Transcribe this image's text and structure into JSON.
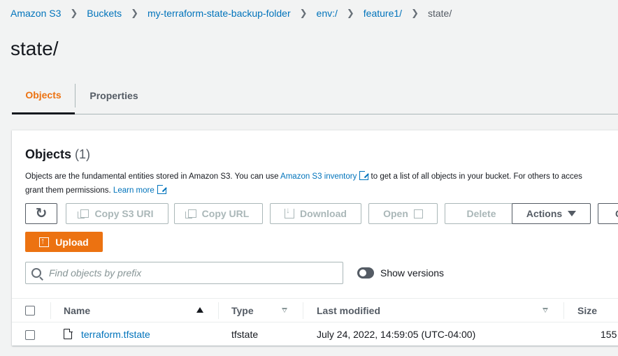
{
  "breadcrumb": {
    "items": [
      "Amazon S3",
      "Buckets",
      "my-terraform-state-backup-folder",
      "env:/",
      "feature1/"
    ],
    "current": "state/"
  },
  "page_title": "state/",
  "tabs": [
    {
      "label": "Objects",
      "active": true
    },
    {
      "label": "Properties",
      "active": false
    }
  ],
  "objects_panel": {
    "title": "Objects",
    "count": "(1)",
    "description_prefix": "Objects are the fundamental entities stored in Amazon S3. You can use ",
    "inventory_link": "Amazon S3 inventory",
    "description_middle": " to get a list of all objects in your bucket. For others to acces",
    "description_line2": "grant them permissions. ",
    "learn_more_link": "Learn more"
  },
  "toolbar": {
    "copy_uri_label": "Copy S3 URI",
    "copy_url_label": "Copy URL",
    "download_label": "Download",
    "open_label": "Open",
    "delete_label": "Delete",
    "actions_label": "Actions",
    "create_label": "C",
    "upload_label": "Upload"
  },
  "search": {
    "placeholder": "Find objects by prefix"
  },
  "show_versions": {
    "label": "Show versions",
    "enabled": false
  },
  "table": {
    "columns": [
      "Name",
      "Type",
      "Last modified",
      "Size"
    ],
    "rows": [
      {
        "name": "terraform.tfstate",
        "type": "tfstate",
        "last_modified": "July 24, 2022, 14:59:05 (UTC-04:00)",
        "size": "155"
      }
    ]
  },
  "colors": {
    "accent": "#ec7211",
    "link": "#0073bb",
    "text": "#16191f",
    "muted": "#545b64",
    "background": "#f2f3f3"
  },
  "icons": [
    "chevron-right-icon",
    "external-link-icon",
    "refresh-icon",
    "copy-icon",
    "download-icon",
    "caret-down-icon",
    "upload-icon",
    "search-icon",
    "sort-ascending-icon",
    "sort-icon",
    "file-icon"
  ]
}
